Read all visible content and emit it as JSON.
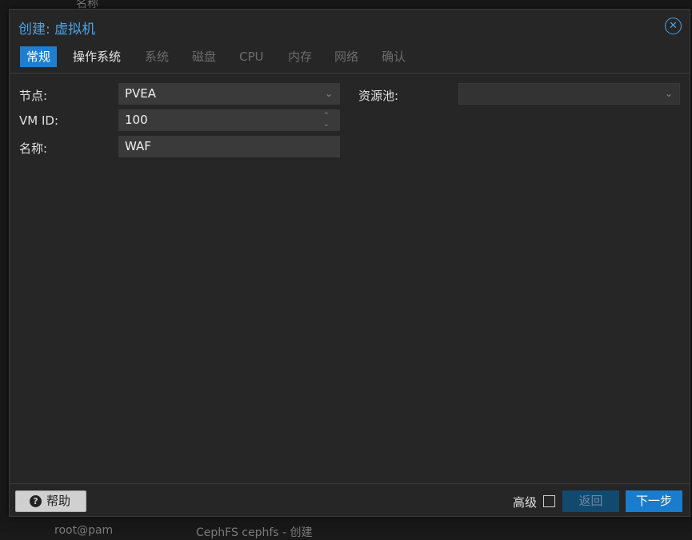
{
  "background": {
    "top_text": "名称",
    "bottom_text_1": "root@pam",
    "bottom_text_2": "CephFS cephfs - 创建"
  },
  "dialog": {
    "title": "创建: 虚拟机",
    "close_glyph": "✕"
  },
  "tabs": [
    {
      "label": "常规",
      "state": "active"
    },
    {
      "label": "操作系统",
      "state": "enabled"
    },
    {
      "label": "系统",
      "state": "disabled"
    },
    {
      "label": "磁盘",
      "state": "disabled"
    },
    {
      "label": "CPU",
      "state": "disabled"
    },
    {
      "label": "内存",
      "state": "disabled"
    },
    {
      "label": "网络",
      "state": "disabled"
    },
    {
      "label": "确认",
      "state": "disabled"
    }
  ],
  "form": {
    "node_label": "节点:",
    "node_value": "PVEA",
    "vmid_label": "VM ID:",
    "vmid_value": "100",
    "name_label": "名称:",
    "name_value": "WAF",
    "pool_label": "资源池:",
    "pool_value": ""
  },
  "footer": {
    "help_label": "帮助",
    "advanced_label": "高级",
    "advanced_checked": false,
    "back_label": "返回",
    "next_label": "下一步"
  },
  "colors": {
    "accent": "#1e7fd0",
    "title": "#4aa3e8",
    "dialog_bg": "#262626"
  }
}
